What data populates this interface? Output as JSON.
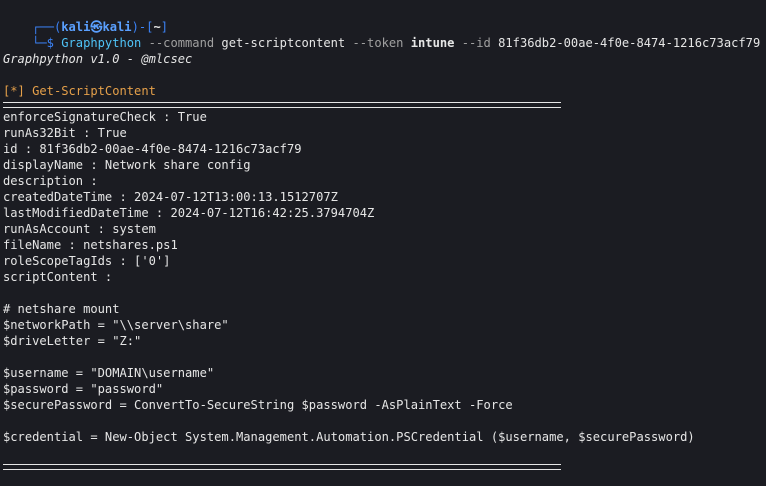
{
  "prompt": {
    "corner_top": "┌──(",
    "user_host": "kali㉿kali",
    "close_paren": ")-[",
    "path": "~",
    "close_bracket": "]",
    "corner_bottom": "└─$ ",
    "command": "Graphpython",
    "flag1": " --command",
    "value1": " get-scriptcontent",
    "flag2": " --token",
    "value2": " intune",
    "flag3": " --id",
    "value3": " 81f36db2-00ae-4f0e-8474-1216c73acf79"
  },
  "banner": "Graphpython v1.0 - @mlcsec",
  "section_header": "[*] Get-ScriptContent",
  "properties": [
    "enforceSignatureCheck : True",
    "runAs32Bit : True",
    "id : 81f36db2-00ae-4f0e-8474-1216c73acf79",
    "displayName : Network share config",
    "description :",
    "createdDateTime : 2024-07-12T13:00:13.1512707Z",
    "lastModifiedDateTime : 2024-07-12T16:42:25.3794704Z",
    "runAsAccount : system",
    "fileName : netshares.ps1",
    "roleScopeTagIds : ['0']",
    "scriptContent :"
  ],
  "script_lines": [
    "# netshare mount",
    "$networkPath = \"\\\\server\\share\"",
    "$driveLetter = \"Z:\"",
    "",
    "$username = \"DOMAIN\\username\"",
    "$password = \"password\"",
    "$securePassword = ConvertTo-SecureString $password -AsPlainText -Force",
    "",
    "$credential = New-Object System.Management.Automation.PSCredential ($username, $securePassword)"
  ]
}
